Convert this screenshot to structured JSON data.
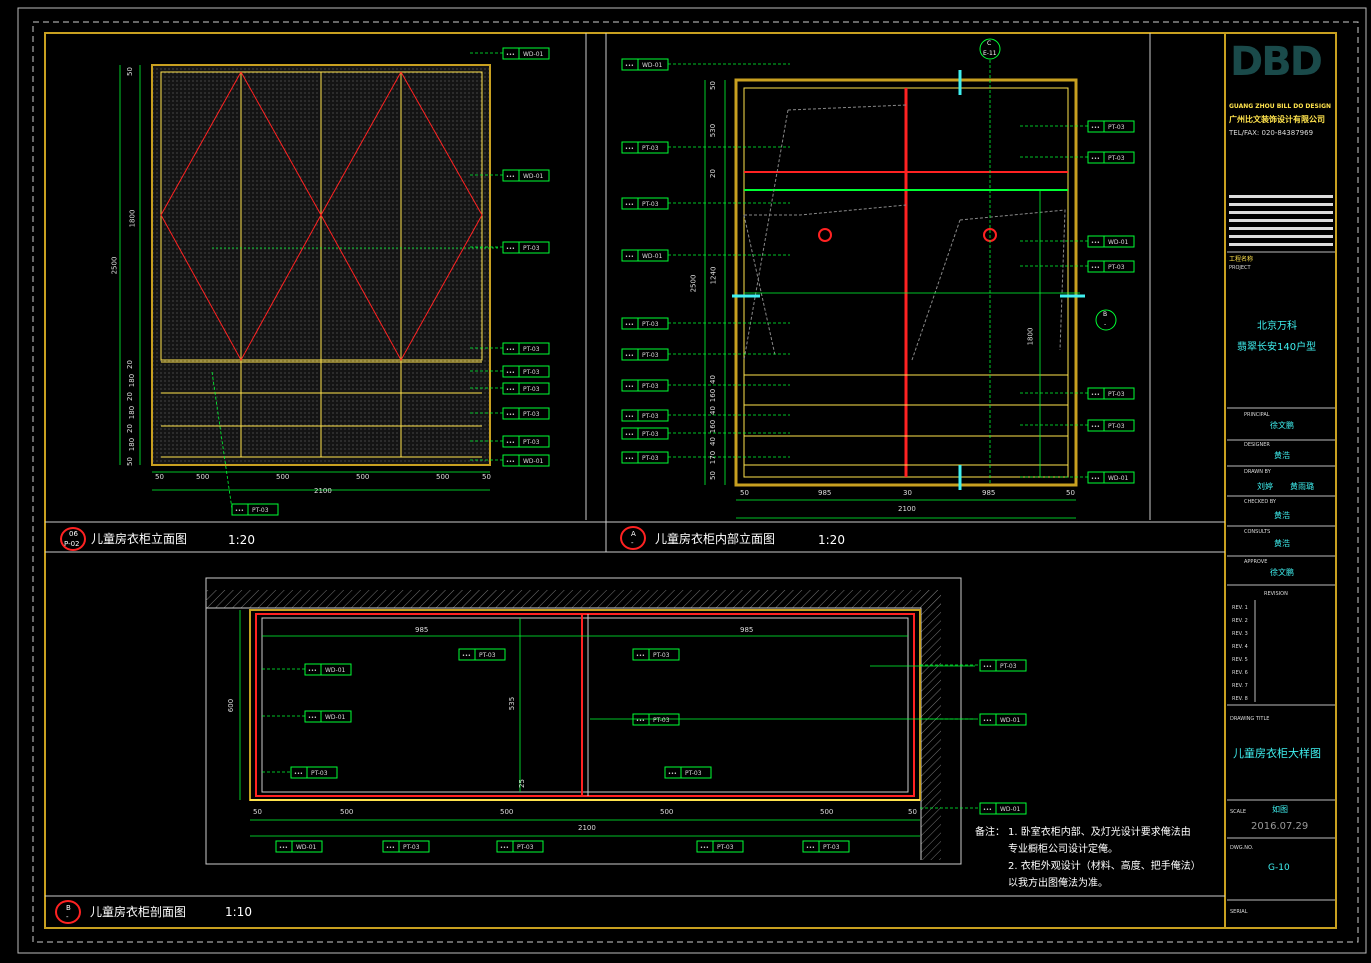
{
  "colors": {
    "frame": "#c8a020",
    "green": "#00ff33",
    "red": "#ff2222",
    "cyan": "#3ff0f0",
    "yellow": "#ffe34d",
    "white": "#ffffff",
    "panel": "#2a2a2a"
  },
  "views": {
    "elevation": {
      "badge_top": "06",
      "badge_bottom": "P-02",
      "title": "儿童房衣柜立面图",
      "scale": "1:20"
    },
    "interior": {
      "badge_top": "A",
      "badge_bottom": "-",
      "title": "儿童房衣柜内部立面图",
      "scale": "1:20"
    },
    "section": {
      "badge_top": "B",
      "badge_bottom": "-",
      "title": "儿童房衣柜剖面图",
      "scale": "1:10"
    }
  },
  "elevation_dims": {
    "bottom": [
      "50",
      "500",
      "500",
      "500",
      "500",
      "50"
    ],
    "total": "2100",
    "left": [
      "50",
      "1800",
      "20",
      "180",
      "20",
      "180",
      "20",
      "180",
      "50"
    ],
    "height": "2500"
  },
  "interior_dims": {
    "bottom": [
      "50",
      "985",
      "30",
      "985",
      "50"
    ],
    "total": "2100",
    "left": [
      "50",
      "530",
      "20",
      "1240",
      "40",
      "160",
      "40",
      "160",
      "40",
      "170",
      "50"
    ],
    "height": "2500",
    "right": "1800"
  },
  "section_dims": {
    "top": [
      "985",
      "985"
    ],
    "bottom": [
      "50",
      "500",
      "500",
      "500",
      "500",
      "50"
    ],
    "total": "2100",
    "depth": "600",
    "inner": "535",
    "small": "25"
  },
  "tags": {
    "elev_right": [
      "WD-01",
      "WD-01",
      "PT-03",
      "PT-03",
      "PT-03",
      "PT-03",
      "PT-03",
      "PT-03",
      "WD-01"
    ],
    "elev_bottom": "PT-03",
    "int_left": [
      "WD-01",
      "PT-03",
      "PT-03",
      "WD-01",
      "PT-03",
      "PT-03",
      "PT-03",
      "PT-03",
      "PT-03",
      "PT-03"
    ],
    "int_right": [
      "PT-03",
      "PT-03",
      "WD-01",
      "PT-03",
      "PT-03",
      "PT-03",
      "WD-01"
    ],
    "sec_left": [
      "WD-01",
      "WD-01",
      "PT-03"
    ],
    "sec_inner": [
      "PT-03",
      "PT-03",
      "PT-03",
      "PT-03"
    ],
    "sec_right": [
      "PT-03",
      "WD-01",
      "WD-01"
    ],
    "sec_bottom": [
      "WD-01",
      "PT-03",
      "PT-03",
      "PT-03",
      "PT-03"
    ]
  },
  "markers": {
    "top_top": "C",
    "top_bottom": "E-11",
    "right_top": "B",
    "right_bottom": "-"
  },
  "notes": {
    "label": "备注：",
    "line1": "1. 卧室衣柜内部、及灯光设计要求俺法由",
    "line2": "专业橱柜公司设计定俺。",
    "line3": "2. 衣柜外观设计（材料、高度、把手俺法）",
    "line4": "以我方出图俺法为准。"
  },
  "title_block": {
    "logo": "DBD",
    "company_en": "GUANG ZHOU BILL DO DESIGN",
    "company_cn": "广州比文装饰设计有限公司",
    "tel": "TEL/FAX: 020-84387969",
    "project_label_cn": "工程名称",
    "project_label": "PROJECT",
    "project_line1": "北京万科",
    "project_line2": "翡翠长安140户型",
    "principal_label": "PRINCIPAL",
    "principal": "徐文鹏",
    "designer_label": "DESIGNER",
    "designer": "黄浩",
    "drawn_label": "DRAWN BY",
    "drawn1": "刘婷",
    "drawn2": "黄雨璐",
    "checked_label": "CHECKED BY",
    "checked": "黄浩",
    "consult_label": "CONSULTS",
    "consult": "黄浩",
    "approve_label": "APPROVE",
    "approve": "徐文鹏",
    "revision_label": "REVISION",
    "revs": [
      "REV. 1",
      "REV. 2",
      "REV. 3",
      "REV. 4",
      "REV. 5",
      "REV. 6",
      "REV. 7",
      "REV. 8"
    ],
    "drawing_title_label": "DRAWING TITLE",
    "drawing_title": "儿童房衣柜大样图",
    "scale_label": "SCALE",
    "scale": "如图",
    "date": "2016.07.29",
    "dwg_no_label": "DWG.NO.",
    "dwg_no": "G-10",
    "serial_label": "SERIAL"
  }
}
